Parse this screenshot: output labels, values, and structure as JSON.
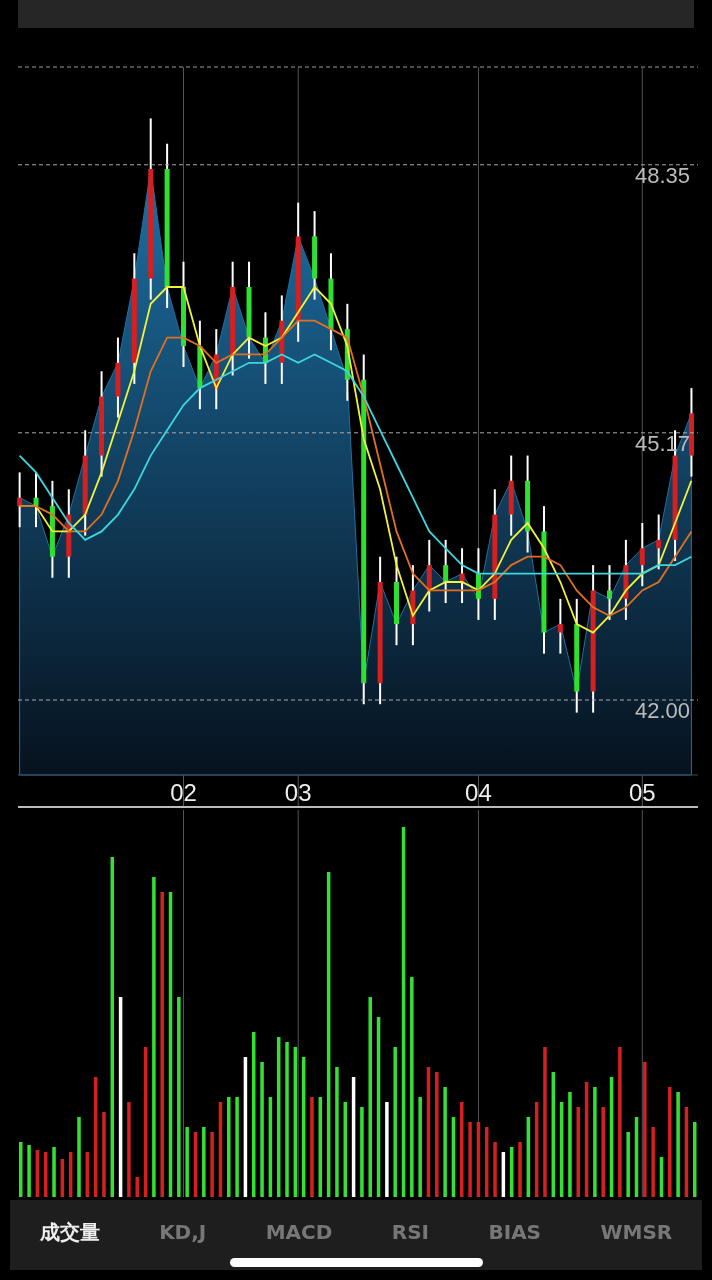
{
  "price_chart": {
    "chart_data": {
      "type": "candlestick",
      "categories": [
        null,
        null,
        null,
        null,
        null,
        null,
        null,
        null,
        null,
        null,
        "02",
        null,
        null,
        null,
        null,
        null,
        null,
        "03",
        null,
        null,
        null,
        null,
        null,
        null,
        null,
        null,
        null,
        null,
        "04",
        null,
        null,
        null,
        null,
        null,
        null,
        null,
        null,
        null,
        "05",
        null,
        null,
        null
      ],
      "ohlc": [
        [
          44.3,
          44.7,
          44.05,
          44.4
        ],
        [
          44.4,
          44.7,
          44.05,
          44.3
        ],
        [
          44.3,
          44.6,
          43.45,
          43.7
        ],
        [
          43.7,
          44.5,
          43.45,
          44.2
        ],
        [
          44.2,
          45.2,
          43.95,
          44.9
        ],
        [
          44.9,
          45.9,
          44.65,
          45.6
        ],
        [
          45.6,
          46.3,
          45.35,
          46.0
        ],
        [
          46.0,
          47.3,
          45.75,
          47.0
        ],
        [
          47.0,
          48.9,
          46.75,
          48.3
        ],
        [
          48.3,
          48.6,
          46.65,
          46.9
        ],
        [
          46.9,
          47.2,
          45.95,
          46.2
        ],
        [
          46.2,
          46.5,
          45.45,
          45.7
        ],
        [
          45.7,
          46.4,
          45.45,
          46.1
        ],
        [
          46.1,
          47.2,
          45.85,
          46.9
        ],
        [
          46.9,
          47.2,
          46.05,
          46.3
        ],
        [
          46.3,
          46.6,
          45.75,
          46.0
        ],
        [
          46.0,
          46.8,
          45.75,
          46.5
        ],
        [
          46.5,
          47.9,
          46.25,
          47.5
        ],
        [
          47.5,
          47.8,
          46.75,
          47.0
        ],
        [
          47.0,
          47.3,
          46.15,
          46.4
        ],
        [
          46.4,
          46.7,
          45.55,
          45.8
        ],
        [
          45.8,
          46.1,
          41.95,
          42.2
        ],
        [
          42.2,
          43.7,
          41.95,
          43.4
        ],
        [
          43.4,
          43.7,
          42.65,
          42.9
        ],
        [
          42.9,
          43.6,
          42.65,
          43.3
        ],
        [
          43.3,
          43.9,
          43.05,
          43.6
        ],
        [
          43.6,
          43.9,
          43.15,
          43.4
        ],
        [
          43.4,
          43.8,
          43.15,
          43.5
        ],
        [
          43.5,
          43.8,
          42.95,
          43.2
        ],
        [
          43.2,
          44.5,
          42.95,
          44.2
        ],
        [
          44.2,
          44.9,
          43.95,
          44.6
        ],
        [
          44.6,
          44.9,
          43.75,
          44.0
        ],
        [
          44.0,
          44.3,
          42.55,
          42.8
        ],
        [
          42.8,
          43.2,
          42.55,
          42.9
        ],
        [
          42.9,
          43.2,
          41.85,
          42.1
        ],
        [
          42.1,
          43.6,
          41.85,
          43.3
        ],
        [
          43.3,
          43.6,
          42.95,
          43.2
        ],
        [
          43.2,
          43.9,
          42.95,
          43.6
        ],
        [
          43.6,
          44.1,
          43.35,
          43.8
        ],
        [
          43.8,
          44.2,
          43.55,
          43.9
        ],
        [
          43.9,
          45.2,
          43.65,
          44.9
        ],
        [
          44.9,
          45.7,
          44.65,
          45.4
        ]
      ],
      "series": [
        {
          "type": "area",
          "color": "#1d6fa3",
          "values": [
            44.4,
            44.3,
            43.7,
            44.2,
            44.9,
            45.6,
            46.0,
            47.0,
            48.3,
            46.9,
            46.2,
            45.7,
            46.1,
            46.9,
            46.3,
            46.0,
            46.5,
            47.5,
            47.0,
            46.4,
            45.8,
            42.2,
            43.4,
            42.9,
            43.3,
            43.6,
            43.4,
            43.5,
            43.2,
            44.2,
            44.6,
            44.0,
            42.8,
            42.9,
            42.1,
            43.3,
            43.2,
            43.6,
            43.8,
            43.9,
            44.9,
            45.4
          ]
        },
        {
          "type": "line",
          "color": "#f2f23a",
          "values": [
            44.3,
            44.3,
            44.0,
            44.0,
            44.2,
            44.7,
            45.3,
            45.9,
            46.7,
            46.9,
            46.9,
            46.2,
            45.7,
            46.1,
            46.3,
            46.2,
            46.3,
            46.6,
            46.9,
            46.7,
            46.2,
            45.1,
            44.5,
            43.6,
            43.0,
            43.3,
            43.4,
            43.4,
            43.3,
            43.5,
            43.9,
            44.1,
            43.8,
            43.4,
            42.9,
            42.8,
            43.0,
            43.3,
            43.5,
            43.6,
            44.1,
            44.6
          ]
        },
        {
          "type": "line",
          "color": "#e07020",
          "values": [
            44.3,
            44.3,
            44.2,
            44.0,
            44.0,
            44.2,
            44.6,
            45.2,
            45.9,
            46.3,
            46.3,
            46.2,
            46.0,
            46.1,
            46.1,
            46.1,
            46.3,
            46.5,
            46.5,
            46.4,
            46.3,
            45.6,
            44.8,
            44.0,
            43.5,
            43.3,
            43.3,
            43.3,
            43.3,
            43.4,
            43.6,
            43.7,
            43.7,
            43.6,
            43.3,
            43.1,
            43.0,
            43.1,
            43.3,
            43.4,
            43.7,
            44.0
          ]
        },
        {
          "type": "line",
          "color": "#3ad8e0",
          "values": [
            44.9,
            44.7,
            44.4,
            44.1,
            43.9,
            44.0,
            44.2,
            44.5,
            44.9,
            45.2,
            45.5,
            45.7,
            45.8,
            45.9,
            46.0,
            46.0,
            46.1,
            46.0,
            46.1,
            46.0,
            45.9,
            45.6,
            45.2,
            44.8,
            44.4,
            44.0,
            43.8,
            43.6,
            43.5,
            43.5,
            43.5,
            43.5,
            43.5,
            43.5,
            43.5,
            43.5,
            43.5,
            43.5,
            43.5,
            43.6,
            43.6,
            43.7
          ]
        }
      ],
      "ylim": [
        41.11,
        49.51
      ],
      "grid": true,
      "yticks": [
        {
          "value": 48.35,
          "label": "48.35"
        },
        {
          "value": 45.17,
          "label": "45.17"
        },
        {
          "value": 42.0,
          "label": "42.00"
        }
      ]
    }
  },
  "indicator_tabs": [
    {
      "label": "成交量",
      "selected": true
    },
    {
      "label": "KD,J",
      "selected": false
    },
    {
      "label": "MACD",
      "selected": false
    },
    {
      "label": "RSI",
      "selected": false
    },
    {
      "label": "BIAS",
      "selected": false
    },
    {
      "label": "WMSR",
      "selected": false
    }
  ]
}
